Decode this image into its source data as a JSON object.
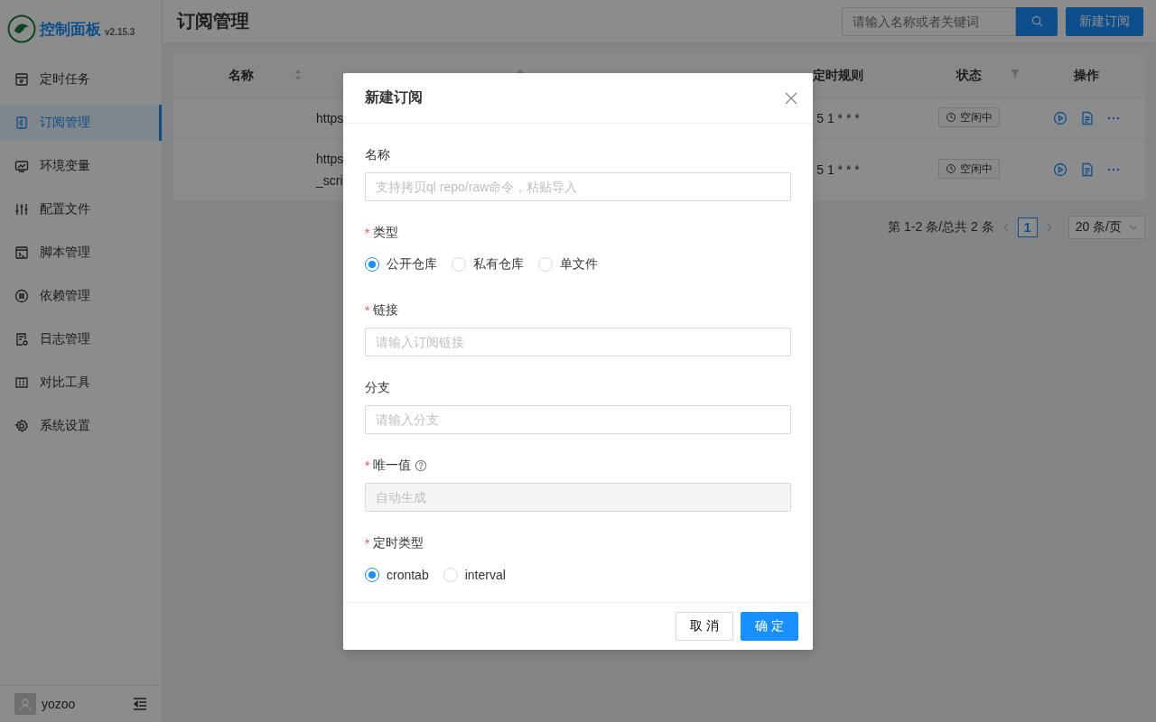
{
  "sidebar": {
    "logo": {
      "title": "控制面板",
      "version": "v2.15.3"
    },
    "items": [
      {
        "label": "定时任务",
        "selected": false
      },
      {
        "label": "订阅管理",
        "selected": true
      },
      {
        "label": "环境变量",
        "selected": false
      },
      {
        "label": "配置文件",
        "selected": false
      },
      {
        "label": "脚本管理",
        "selected": false
      },
      {
        "label": "依赖管理",
        "selected": false
      },
      {
        "label": "日志管理",
        "selected": false
      },
      {
        "label": "对比工具",
        "selected": false
      },
      {
        "label": "系统设置",
        "selected": false
      }
    ],
    "user": {
      "name": "yozoo"
    }
  },
  "header": {
    "title": "订阅管理",
    "search": {
      "placeholder": "请输入名称或者关键词"
    },
    "new_button": "新建订阅"
  },
  "table": {
    "columns": [
      {
        "label": "名称",
        "sortable": true
      },
      {
        "sortable": true
      },
      {},
      {},
      {
        "label": "定时规则"
      },
      {
        "label": "状态",
        "filterable": true
      },
      {
        "label": "操作"
      }
    ],
    "rows": [
      {
        "link": [
          "https"
        ],
        "schedule": "5 1 * * *",
        "status": "空闲中"
      },
      {
        "link": [
          "https",
          "_scri"
        ],
        "schedule": "5 1 * * *",
        "status": "空闲中"
      }
    ]
  },
  "pagination": {
    "summary": "第 1-2 条/总共 2 条",
    "pages": [
      {
        "label": "1",
        "selected": true
      }
    ],
    "page_size": "20 条/页"
  },
  "modal": {
    "title": "新建订阅",
    "fields": [
      {
        "kind": "text",
        "label": "名称",
        "placeholder": "支持拷贝ql repo/raw命令，粘贴导入"
      },
      {
        "kind": "radio",
        "marker": "*",
        "label": "类型",
        "options": [
          {
            "label": "公开仓库",
            "selected": true
          },
          {
            "label": "私有仓库",
            "selected": false
          },
          {
            "label": "单文件",
            "selected": false
          }
        ]
      },
      {
        "kind": "text",
        "marker": "*",
        "label": "链接",
        "placeholder": "请输入订阅链接"
      },
      {
        "kind": "text",
        "label": "分支",
        "placeholder": "请输入分支"
      },
      {
        "kind": "disabled",
        "marker": "*",
        "label": "唯一值",
        "help": true,
        "placeholder": "自动生成"
      },
      {
        "kind": "radio",
        "marker": "*",
        "label": "定时类型",
        "options": [
          {
            "label": "crontab",
            "selected": true
          },
          {
            "label": "interval",
            "selected": false
          }
        ]
      }
    ],
    "cancel": "取 消",
    "ok": "确 定"
  }
}
